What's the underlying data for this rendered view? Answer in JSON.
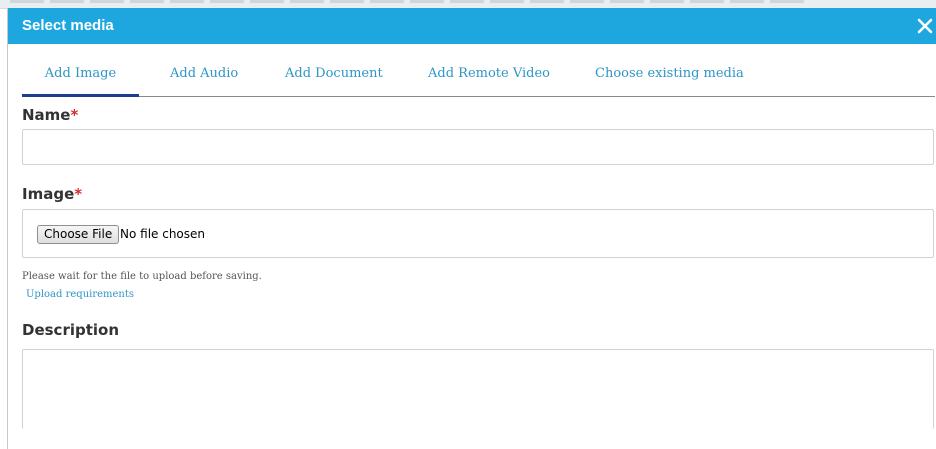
{
  "dialog": {
    "title": "Select media",
    "close_icon": "close-icon"
  },
  "tabs": [
    {
      "label": "Add Image",
      "active": true
    },
    {
      "label": "Add Audio",
      "active": false
    },
    {
      "label": "Add Document",
      "active": false
    },
    {
      "label": "Add Remote Video",
      "active": false
    },
    {
      "label": "Choose existing media",
      "active": false
    }
  ],
  "form": {
    "name": {
      "label": "Name",
      "required_marker": "*",
      "value": ""
    },
    "image": {
      "label": "Image",
      "required_marker": "*",
      "button_label": "Choose File",
      "status_text": "No file chosen",
      "help_text": "Please wait for the file to upload before saving.",
      "requirements_link": "Upload requirements"
    },
    "description": {
      "label": "Description",
      "value": ""
    }
  },
  "colors": {
    "titlebar": "#1ea7de",
    "tab_text": "#2e96c6",
    "active_tab_underline": "#1d3d8f",
    "required": "#d62c2c"
  }
}
